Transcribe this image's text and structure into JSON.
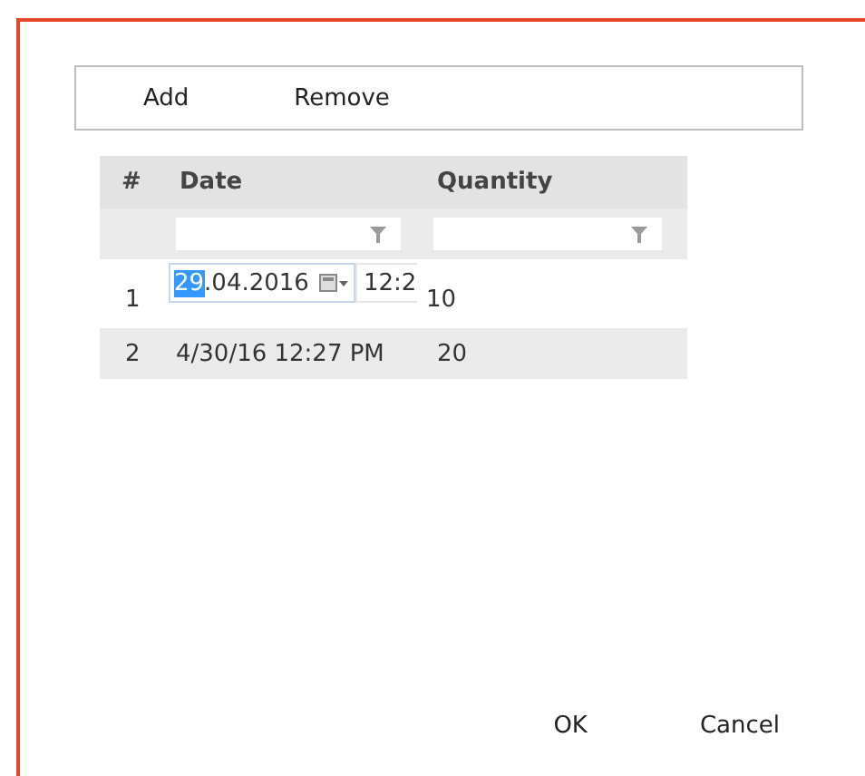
{
  "toolbar": {
    "buttons": [
      "Add",
      "Remove"
    ]
  },
  "table": {
    "columns": [
      "#",
      "Date",
      "Quantity"
    ],
    "filters": [
      {
        "kind": "text"
      },
      {
        "kind": "text"
      }
    ],
    "rows": [
      {
        "kind": "editing",
        "number": "1",
        "date_parts": [
          {
            "text": "29",
            "selected": true
          },
          {
            "text": ".04.2016",
            "selected": false
          }
        ],
        "time_value": "12:2",
        "quantity": "10"
      },
      {
        "kind": "display",
        "number": "2",
        "date": "4/30/16 12:27 PM",
        "quantity": "20"
      }
    ]
  },
  "buttons": [
    "OK",
    "Cancel"
  ]
}
